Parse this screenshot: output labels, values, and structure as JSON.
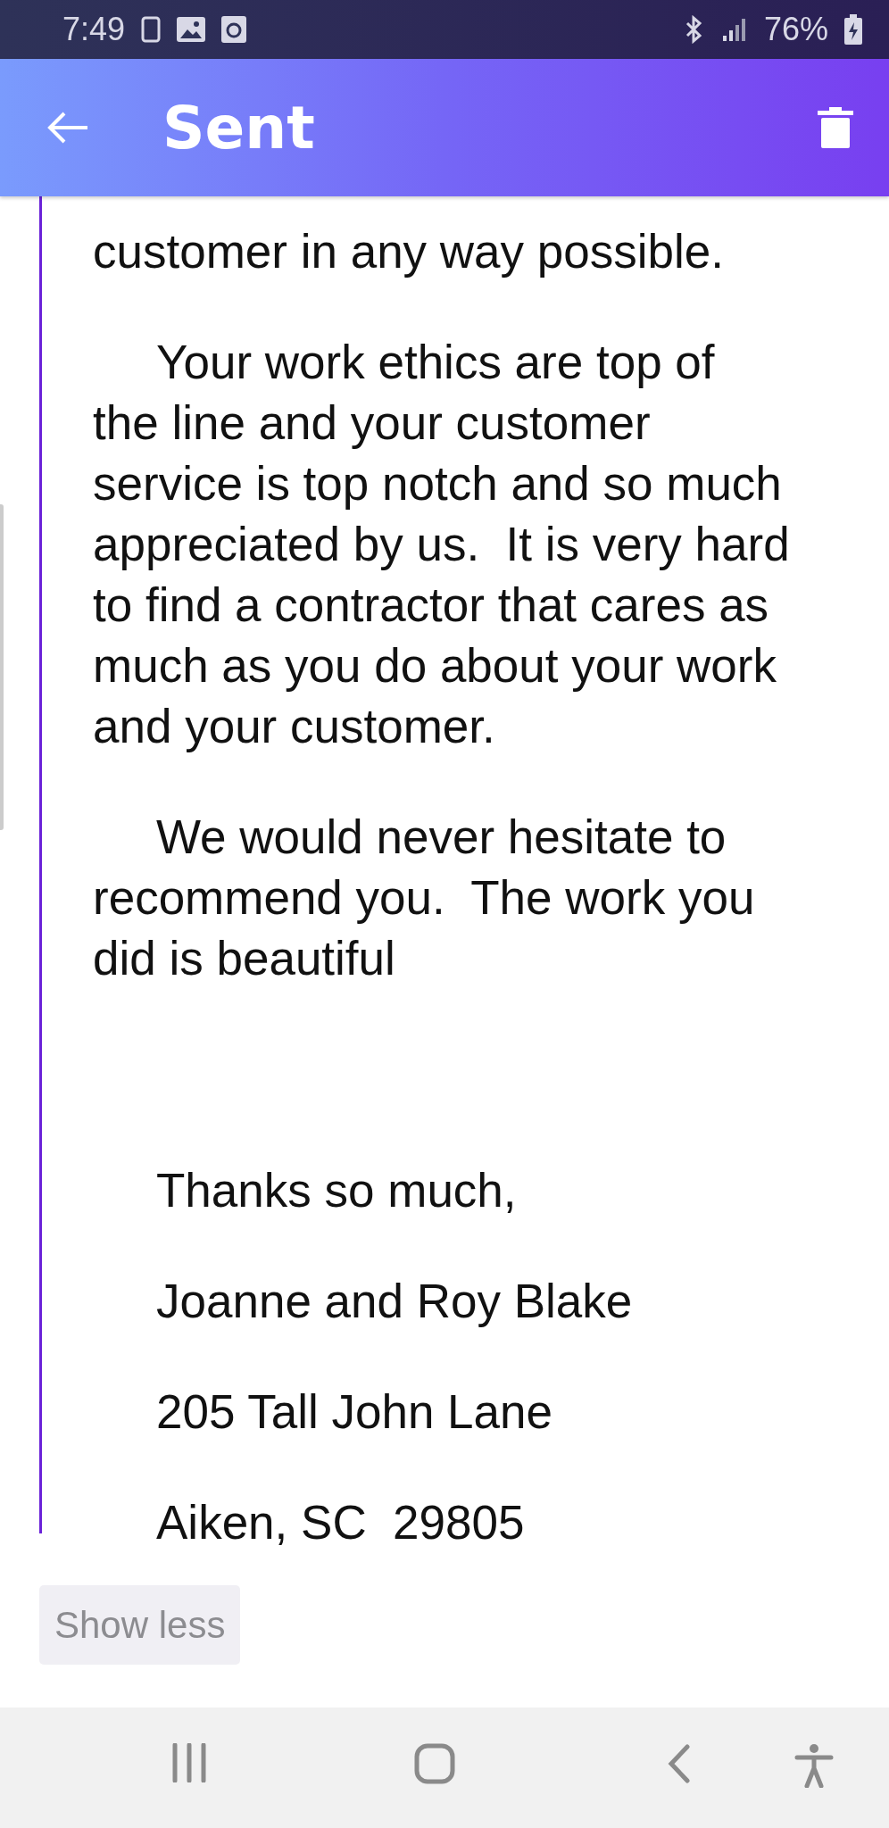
{
  "status_bar": {
    "time": "7:49",
    "battery": "76%"
  },
  "header": {
    "title": "Sent"
  },
  "message": {
    "paragraphs": [
      {
        "kind": "plain",
        "lines": [
          "customer in any way possible."
        ]
      },
      {
        "kind": "indented",
        "lines": [
          "Your work ethics are top of",
          "the line and your customer",
          "service is top notch and so much",
          "appreciated by us.  It is very hard",
          "to find a contractor that cares as",
          "much as you do about your work",
          "and your customer."
        ]
      },
      {
        "kind": "indented",
        "lines": [
          "We would never hesitate to",
          "recommend you.  The work you",
          "did is beautiful"
        ]
      }
    ],
    "signature": [
      "Thanks so much,",
      "Joanne and Roy Blake",
      "205 Tall John Lane",
      "Aiken, SC  29805"
    ]
  },
  "show_less_button": "Show less"
}
